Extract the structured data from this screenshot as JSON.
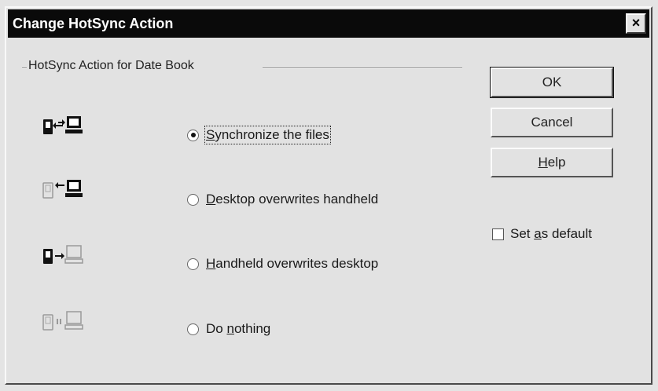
{
  "window": {
    "title": "Change HotSync Action",
    "close_label": "×"
  },
  "group": {
    "label": "HotSync Action for Date Book"
  },
  "options": [
    {
      "pre": "",
      "key": "S",
      "post": "ynchronize the files",
      "selected": true,
      "icon": "sync-both-icon"
    },
    {
      "pre": "",
      "key": "D",
      "post": "esktop overwrites handheld",
      "selected": false,
      "icon": "desktop-to-handheld-icon"
    },
    {
      "pre": "",
      "key": "H",
      "post": "andheld overwrites desktop",
      "selected": false,
      "icon": "handheld-to-desktop-icon"
    },
    {
      "pre": "Do ",
      "key": "n",
      "post": "othing",
      "selected": false,
      "icon": "do-nothing-icon"
    }
  ],
  "buttons": {
    "ok": "OK",
    "cancel": "Cancel",
    "help_key": "H",
    "help_rest": "elp"
  },
  "default_checkbox": {
    "pre": "Set ",
    "key": "a",
    "post": "s default",
    "checked": false
  },
  "colors": {
    "titlebar": "#0a0a0a",
    "face": "#e2e2e2"
  }
}
